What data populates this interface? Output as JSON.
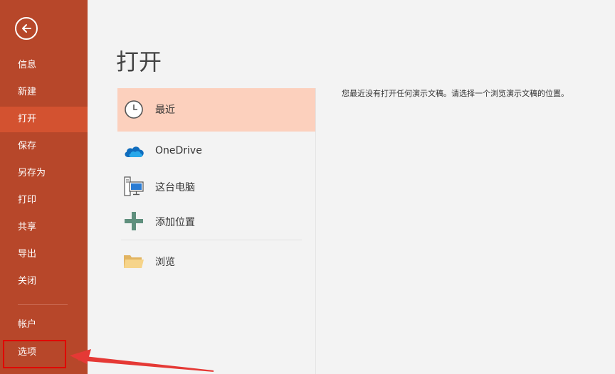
{
  "sidebar": {
    "items": [
      {
        "label": "信息"
      },
      {
        "label": "新建"
      },
      {
        "label": "打开"
      },
      {
        "label": "保存"
      },
      {
        "label": "另存为"
      },
      {
        "label": "打印"
      },
      {
        "label": "共享"
      },
      {
        "label": "导出"
      },
      {
        "label": "关闭"
      },
      {
        "label": "帐户"
      },
      {
        "label": "选项"
      }
    ],
    "selected": "打开",
    "accent_color": "#b7472a",
    "selected_color": "#d35230"
  },
  "main": {
    "title": "打开",
    "locations": [
      {
        "label": "最近",
        "icon": "clock-icon"
      },
      {
        "label": "OneDrive",
        "icon": "cloud-icon"
      },
      {
        "label": "这台电脑",
        "icon": "computer-icon"
      },
      {
        "label": "添加位置",
        "icon": "plus-icon"
      },
      {
        "label": "浏览",
        "icon": "folder-icon"
      }
    ],
    "selected_location": "最近",
    "selected_location_color": "#fcd0bd",
    "message": "您最近没有打开任何演示文稿。请选择一个浏览演示文稿的位置。"
  },
  "annotation": {
    "highlight_color": "#e00000"
  }
}
